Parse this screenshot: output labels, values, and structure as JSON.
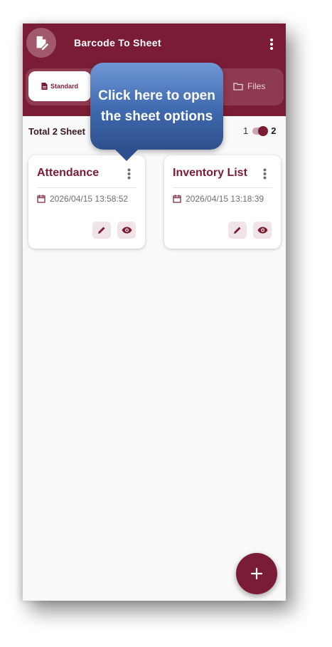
{
  "app": {
    "title": "Barcode To Sheet",
    "logo_icon": "edit-document-icon",
    "menu_icon": "more-vertical-icon"
  },
  "tabs": [
    {
      "label": "Standard",
      "icon": "document-icon",
      "selected": true
    },
    {
      "label": "Files",
      "icon": "folder-icon",
      "selected": false
    }
  ],
  "summary": {
    "total_label": "Total 2 Sheet",
    "toggle_left": "1",
    "toggle_right": "2"
  },
  "sheets": [
    {
      "title": "Attendance",
      "date": "2026/04/15 13:58:52"
    },
    {
      "title": "Inventory List",
      "date": "2026/04/15 13:18:39"
    }
  ],
  "callout": {
    "text": "Click here to open the sheet options"
  },
  "fab": {
    "label": "+"
  },
  "colors": {
    "primary": "#7a1c35",
    "callout": "#3f69ae",
    "background": "#f9f9f9"
  }
}
